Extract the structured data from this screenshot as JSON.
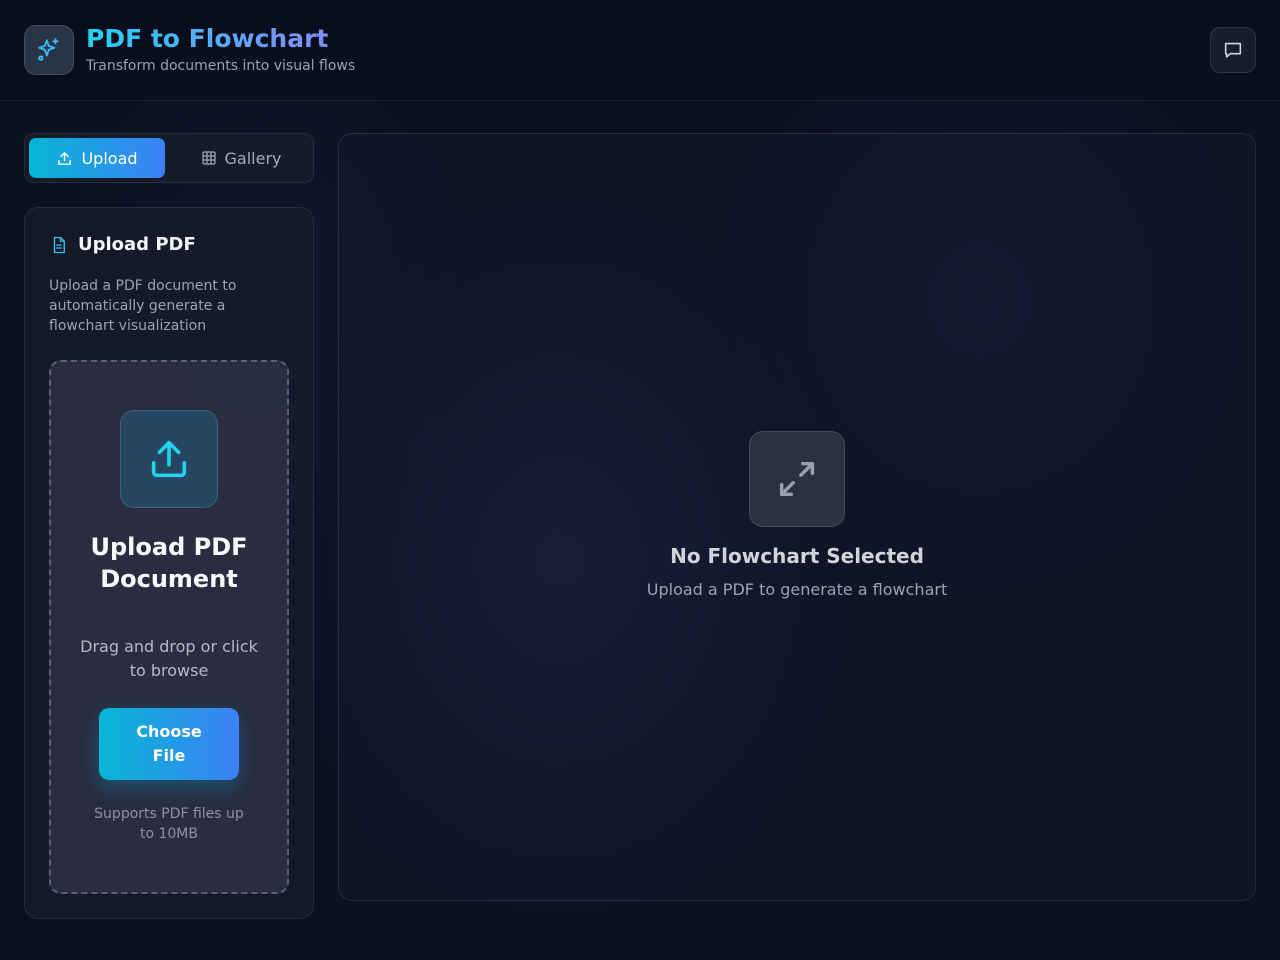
{
  "header": {
    "title": "PDF to Flowchart",
    "subtitle": "Transform documents into visual flows",
    "logo_icon": "sparkles-icon",
    "chat_icon": "chat-bubble-icon"
  },
  "tabs": [
    {
      "label": "Upload",
      "icon": "upload-icon",
      "active": true
    },
    {
      "label": "Gallery",
      "icon": "grid-icon",
      "active": false
    }
  ],
  "upload_card": {
    "title": "Upload PDF",
    "title_icon": "file-text-icon",
    "description": "Upload a PDF document to automatically generate a flowchart visualization",
    "dropzone": {
      "title": "Upload PDF Document",
      "subtitle": "Drag and drop or click to browse",
      "button_label": "Choose File",
      "note": "Supports PDF files up to 10MB"
    }
  },
  "canvas": {
    "empty_title": "No Flowchart Selected",
    "empty_subtitle": "Upload a PDF to generate a flowchart",
    "empty_icon": "expand-arrows-icon"
  },
  "colors": {
    "accent_start": "#06b6d4",
    "accent_end": "#3b82f6",
    "background": "#0b1120"
  }
}
